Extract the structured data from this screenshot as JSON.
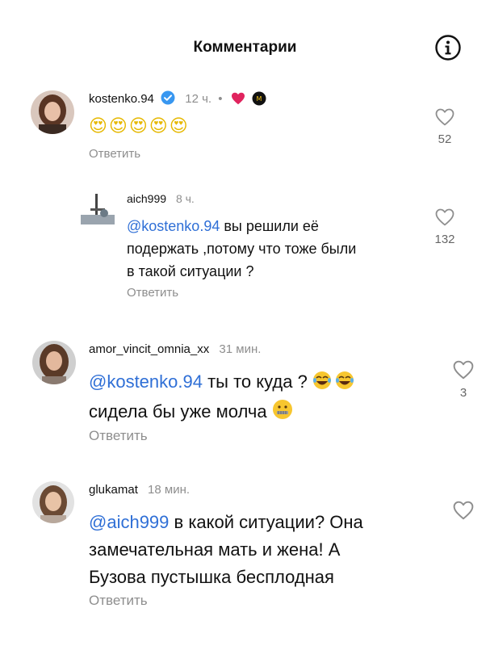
{
  "header": {
    "title": "Комментарии",
    "info_icon": "info-icon"
  },
  "colors": {
    "mention": "#2f6fd6",
    "meta_gray": "#8e8e8e",
    "heart_red": "#e0245e",
    "verified_blue": "#3897f0"
  },
  "comments": [
    {
      "username": "kostenko.94",
      "time": "12 ч.",
      "dot": "•",
      "body_emoji": "😍😍😍😍😍",
      "reply": "Ответить",
      "likes": "52"
    },
    {
      "username": "aich999",
      "time": "8 ч.",
      "mention": "@kostenko.94",
      "text_l1": " вы решили её",
      "text_l2": "подержать ,потому что тоже были",
      "text_l3": "в такой ситуации ?",
      "reply": "Ответить",
      "likes": "132"
    },
    {
      "username": "amor_vincit_omnia_xx",
      "time": "31 мин.",
      "mention": "@kostenko.94",
      "text_l1": " ты то куда ? ",
      "text_l2": "сидела бы уже молча ",
      "reply": "Ответить",
      "likes": "3"
    },
    {
      "username": "glukamat",
      "time": "18 мин.",
      "mention": "@aich999",
      "text_l1": " в какой ситуации? Она",
      "text_l2": "замечательная мать и жена! А",
      "text_l3": "Бузова пустышка бесплодная",
      "reply": "Ответить"
    }
  ]
}
